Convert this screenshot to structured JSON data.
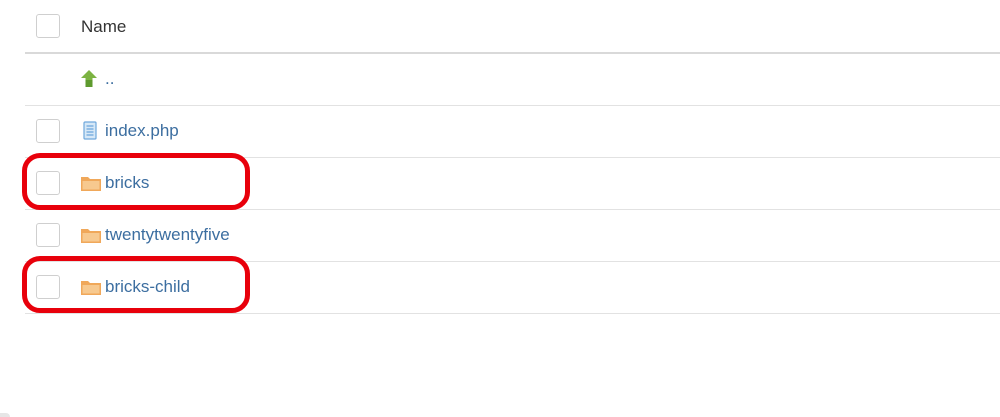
{
  "header": {
    "name_label": "Name"
  },
  "rows": [
    {
      "name": "..",
      "icon": "up-arrow-icon",
      "type": "parent",
      "has_checkbox": false
    },
    {
      "name": "index.php",
      "icon": "php-file-icon",
      "type": "file",
      "has_checkbox": true
    },
    {
      "name": "bricks",
      "icon": "folder-icon",
      "type": "folder",
      "has_checkbox": true,
      "highlighted": true
    },
    {
      "name": "twentytwentyfive",
      "icon": "folder-icon",
      "type": "folder",
      "has_checkbox": true
    },
    {
      "name": "bricks-child",
      "icon": "folder-icon",
      "type": "folder",
      "has_checkbox": true,
      "highlighted": true
    }
  ],
  "colors": {
    "link": "#3c6ea0",
    "highlight": "#e8000b",
    "folder": "#f0a85a",
    "up_arrow": "#7cb342",
    "php_file": "#6fa8dc"
  }
}
